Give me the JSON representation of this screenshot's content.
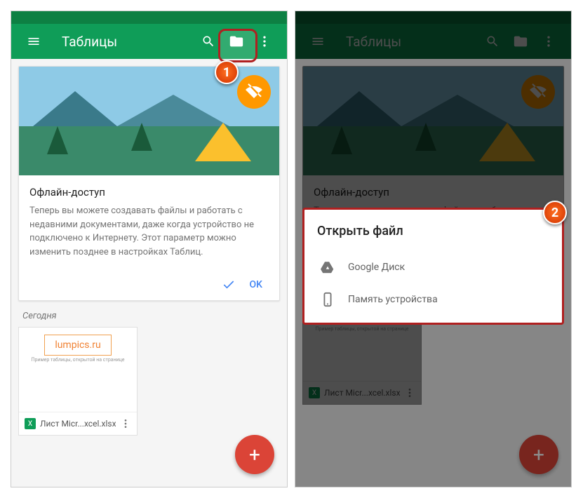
{
  "app": {
    "title": "Таблицы"
  },
  "card": {
    "title": "Офлайн-доступ",
    "text": "Теперь вы можете создавать файлы и работать с недавними документами, даже когда устройство не подключено к Интернету. Этот параметр можно изменить позднее в настройках Таблиц.",
    "ok": "OK"
  },
  "section": {
    "today": "Сегодня"
  },
  "file": {
    "thumb_title": "lumpics.ru",
    "thumb_sub": "Пример таблицы, открытой на странице",
    "name": "Лист Micr...xcel.xlsx",
    "icon_letter": "X"
  },
  "dialog": {
    "title": "Открыть файл",
    "item1": "Google Диск",
    "item2": "Память устройства"
  },
  "annotations": {
    "n1": "1",
    "n2": "2"
  }
}
